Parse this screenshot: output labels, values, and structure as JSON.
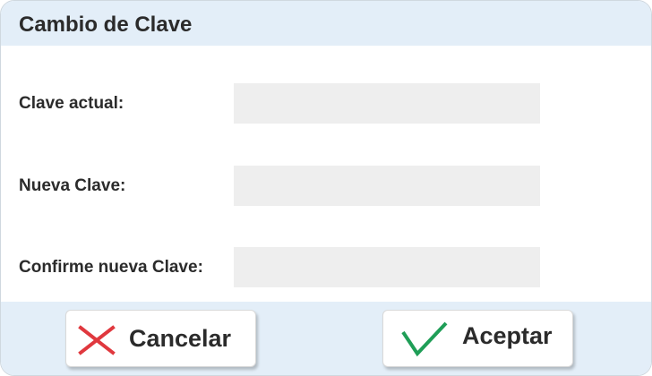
{
  "dialog": {
    "title": "Cambio de Clave"
  },
  "form": {
    "fields": [
      {
        "label": "Clave actual:",
        "value": "",
        "placeholder": ""
      },
      {
        "label": "Nueva Clave:",
        "value": "",
        "placeholder": ""
      },
      {
        "label": "Confirme nueva Clave:",
        "value": "",
        "placeholder": ""
      }
    ]
  },
  "buttons": {
    "cancel": {
      "label": "Cancelar",
      "icon": "close-icon",
      "icon_color": "#e0383e"
    },
    "accept": {
      "label": "Aceptar",
      "icon": "checkmark-icon",
      "icon_color": "#1f9e57"
    }
  },
  "colors": {
    "header_bg": "#e3eef8",
    "footer_bg": "#e3eef8",
    "input_bg": "#eeeeee"
  }
}
